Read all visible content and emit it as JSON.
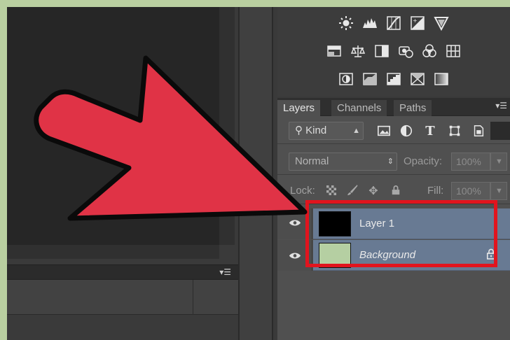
{
  "panel_tabs": [
    {
      "label": "Layers",
      "active": true
    },
    {
      "label": "Channels",
      "active": false
    },
    {
      "label": "Paths",
      "active": false
    }
  ],
  "filter": {
    "kind_label": "Kind"
  },
  "blend": {
    "mode": "Normal",
    "opacity_label": "Opacity:",
    "opacity_value": "100%"
  },
  "lock_row": {
    "lock_label": "Lock:",
    "fill_label": "Fill:",
    "fill_value": "100%"
  },
  "layers": [
    {
      "name": "Layer 1",
      "thumbnail_color": "#000000",
      "visible": true,
      "locked": false,
      "selected": true
    },
    {
      "name": "Background",
      "thumbnail_color": "#b5cfa2",
      "visible": true,
      "locked": true,
      "selected": true
    }
  ],
  "icons": {
    "adjustments_row1": [
      "brightness-icon",
      "levels-icon",
      "curves-icon",
      "exposure-icon",
      "vibrance-icon"
    ],
    "adjustments_row2": [
      "hue-saturation-icon",
      "color-balance-icon",
      "black-white-icon",
      "photo-filter-icon",
      "channel-mixer-icon",
      "color-lookup-icon"
    ],
    "adjustments_row3": [
      "invert-icon",
      "posterize-icon",
      "threshold-icon",
      "selective-color-icon",
      "gradient-map-icon"
    ],
    "filter": [
      "image-filter-icon",
      "adjustment-filter-icon",
      "type-filter-icon",
      "shape-filter-icon",
      "smart-object-filter-icon"
    ],
    "lock": [
      "lock-transparent-icon",
      "lock-brush-icon",
      "lock-move-icon",
      "lock-all-icon"
    ]
  },
  "colors": {
    "arrow_fill": "#e03346",
    "highlight_border": "#e1141e",
    "selected_layer": "#687a93",
    "page_border": "#b9cfa0"
  }
}
